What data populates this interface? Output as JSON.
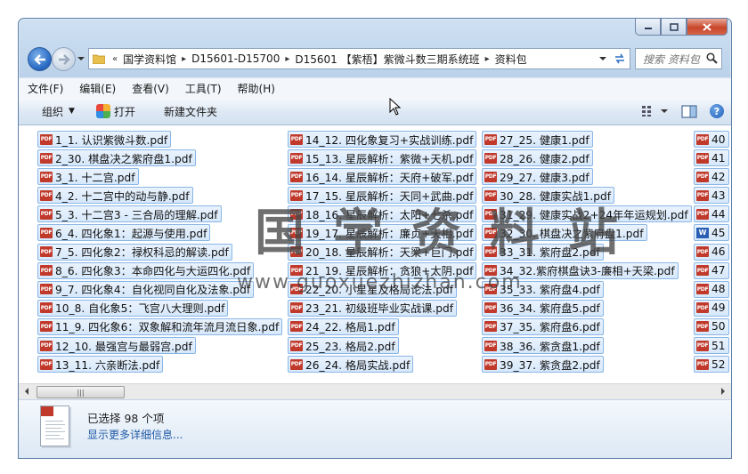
{
  "window": {
    "controls": {
      "minimize_icon": "minimize-icon",
      "maximize_icon": "maximize-icon",
      "close_icon": "close-icon"
    }
  },
  "nav": {
    "breadcrumbs": [
      "国学资料馆",
      "D15601-D15700",
      "D15601 【紫梧】紫微斗数三期系统班",
      "资料包"
    ],
    "search_placeholder": "搜索 资料包"
  },
  "menubar": [
    "文件(F)",
    "编辑(E)",
    "查看(V)",
    "工具(T)",
    "帮助(H)"
  ],
  "toolbar": {
    "organize": "组织",
    "open": "打开",
    "new_folder": "新建文件夹"
  },
  "files": {
    "col1": [
      "1_1. 认识紫微斗数.pdf",
      "2_30. 棋盘决之紫府盘1.pdf",
      "3_1. 十二宫.pdf",
      "4_2. 十二宫中的动与静.pdf",
      "5_3. 十二宫3 - 三合局的理解.pdf",
      "6_4. 四化象1：起源与使用.pdf",
      "7_5. 四化象2：禄权科忌的解读.pdf",
      "8_6. 四化象3：本命四化与大运四化.pdf",
      "9_7. 四化象4：自化视同自化及法象.pdf",
      "10_8. 自化象5：飞宫八大理则.pdf",
      "11_9. 四化象6：双象解和流年流月流日象.pdf",
      "12_10. 最强宫与最弱宫.pdf",
      "13_11. 六亲断法.pdf"
    ],
    "col2": [
      "14_12. 四化象复习+实战训练.pdf",
      "15_13. 星辰解析：紫微+天机.pdf",
      "16_14. 星辰解析：天府+破军.pdf",
      "17_15. 星辰解析：天同+武曲.pdf",
      "18_16. 星辰解析：太阳+七杀.pdf",
      "19_17. 星辰解析：廉贞+天相.pdf",
      "20_18. 星辰解析：天梁+巨门.pdf",
      "21_19. 星辰解析：贪狼+太阴.pdf",
      "22_20. 小星星及格局论法.pdf",
      "23_21. 初级班毕业实战课.pdf",
      "24_22. 格局1.pdf",
      "25_23. 格局2.pdf",
      "26_24. 格局实战.pdf"
    ],
    "col3": [
      "27_25. 健康1.pdf",
      "28_26. 健康2.pdf",
      "29_27. 健康3.pdf",
      "30_28. 健康实战1.pdf",
      "31_29. 健康实战2+24年年运规划.pdf",
      "32_30. 棋盘决之紫府盘1.pdf",
      "33_31. 紫府盘2.pdf",
      "34_32.紫府棋盘诀3-廉相+天梁.pdf",
      "35_33. 紫府盘4.pdf",
      "36_34. 紫府盘5.pdf",
      "37_35. 紫府盘6.pdf",
      "38_36. 紫贪盘1.pdf",
      "39_37. 紫贪盘2.pdf"
    ],
    "col4": [
      "40",
      "41",
      "42",
      "43",
      "44",
      "45",
      "46",
      "47",
      "48",
      "49",
      "50",
      "51",
      "52"
    ]
  },
  "details": {
    "selected": "已选择 98 个项",
    "more": "显示更多详细信息..."
  },
  "watermark": {
    "title": "国学资料站",
    "url": "www.guoxuezhizhan.com"
  }
}
